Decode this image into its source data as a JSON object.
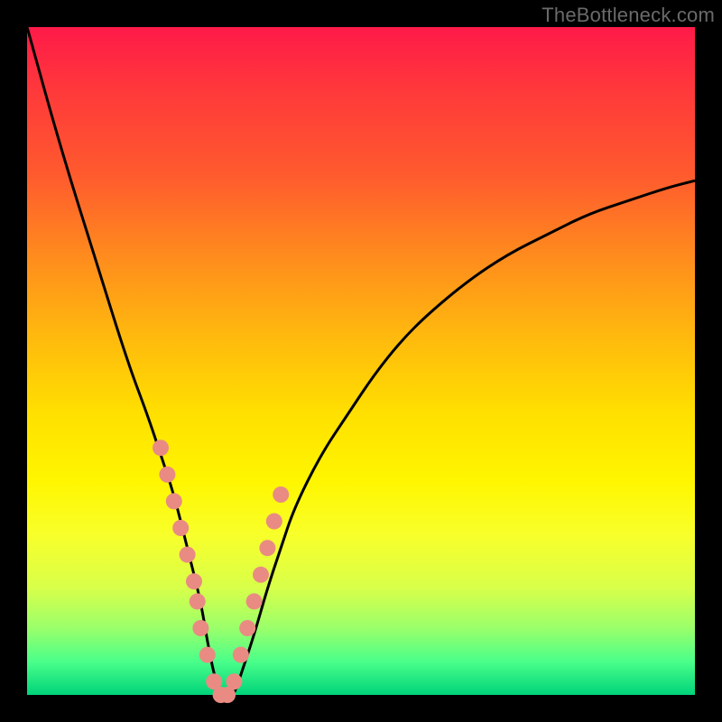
{
  "watermark": "TheBottleneck.com",
  "chart_data": {
    "type": "line",
    "title": "",
    "xlabel": "",
    "ylabel": "",
    "xlim": [
      0,
      100
    ],
    "ylim": [
      0,
      100
    ],
    "grid": false,
    "series": [
      {
        "name": "curve",
        "x": [
          0,
          5,
          10,
          15,
          18,
          20,
          22,
          24,
          26,
          27,
          28,
          29,
          30,
          31,
          32,
          34,
          36,
          38,
          40,
          44,
          48,
          52,
          56,
          60,
          66,
          72,
          78,
          84,
          90,
          96,
          100
        ],
        "y": [
          100,
          82,
          66,
          50,
          42,
          36,
          30,
          22,
          14,
          8,
          3,
          0,
          0,
          0,
          3,
          9,
          16,
          22,
          28,
          36,
          42,
          48,
          53,
          57,
          62,
          66,
          69,
          72,
          74,
          76,
          77
        ]
      },
      {
        "name": "dots",
        "x": [
          20,
          21,
          22,
          23,
          24,
          25,
          25.5,
          26,
          27,
          28,
          29,
          30,
          31,
          32,
          33,
          34,
          35,
          36,
          37,
          38
        ],
        "y": [
          37,
          33,
          29,
          25,
          21,
          17,
          14,
          10,
          6,
          2,
          0,
          0,
          2,
          6,
          10,
          14,
          18,
          22,
          26,
          30
        ]
      }
    ],
    "colors": {
      "curve": "#000000",
      "dots": "#e98b83"
    }
  }
}
